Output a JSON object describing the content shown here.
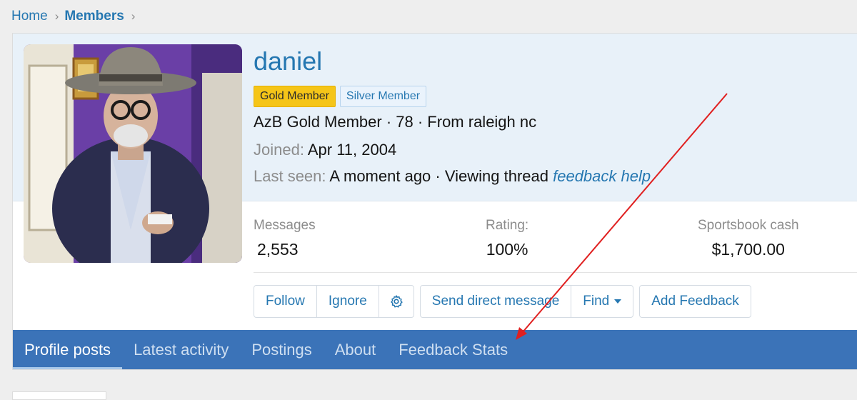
{
  "breadcrumb": {
    "home": "Home",
    "members": "Members"
  },
  "profile": {
    "username": "daniel",
    "banners": [
      "Gold Member",
      "Silver Member"
    ],
    "title_line": "AzB Gold Member · 78 · From raleigh nc",
    "joined_label": "Joined:",
    "joined_value": "Apr 11, 2004",
    "last_seen_label": "Last seen:",
    "last_seen_value": "A moment ago · Viewing thread",
    "last_seen_link": "feedback help"
  },
  "stats": [
    {
      "label": "Messages",
      "value": "2,553"
    },
    {
      "label": "Rating:",
      "value": "100%"
    },
    {
      "label": "Sportsbook cash",
      "value": "$1,700.00"
    }
  ],
  "actions": {
    "follow": "Follow",
    "ignore": "Ignore",
    "send_dm": "Send direct message",
    "find": "Find",
    "add_feedback": "Add Feedback"
  },
  "tabs": [
    "Profile posts",
    "Latest activity",
    "Postings",
    "About",
    "Feedback Stats"
  ],
  "colors": {
    "accent": "#2577b1",
    "tab_bar": "#3b73b8",
    "gold_banner": "#f5c518",
    "annotation_arrow": "#e02020"
  }
}
